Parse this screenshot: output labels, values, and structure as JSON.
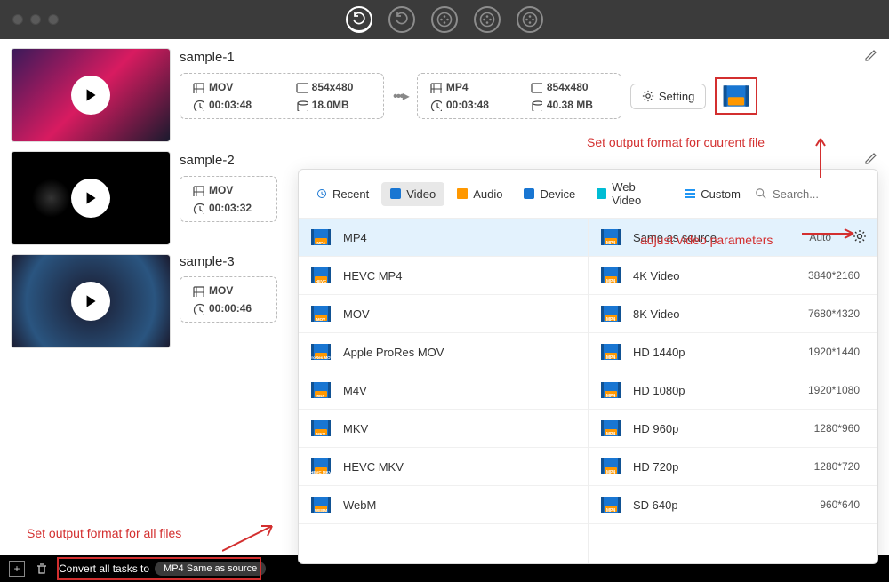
{
  "files": [
    {
      "name": "sample-1",
      "in": {
        "fmt": "MOV",
        "dur": "00:03:48",
        "res": "854x480",
        "size": "18.0MB"
      },
      "out": {
        "fmt": "MP4",
        "dur": "00:03:48",
        "res": "854x480",
        "size": "40.38 MB"
      }
    },
    {
      "name": "sample-2",
      "in": {
        "fmt": "MOV",
        "dur": "00:03:32"
      }
    },
    {
      "name": "sample-3",
      "in": {
        "fmt": "MOV",
        "dur": "00:00:46"
      }
    }
  ],
  "setting_label": "Setting",
  "annotations": {
    "current_file": "Set output format for cuurent file",
    "params": "adjust video parameters",
    "all_files": "Set output format for all files"
  },
  "panel": {
    "tabs": [
      "Recent",
      "Video",
      "Audio",
      "Device",
      "Web Video",
      "Custom"
    ],
    "search_placeholder": "Search...",
    "left": [
      "MP4",
      "HEVC MP4",
      "MOV",
      "Apple ProRes MOV",
      "M4V",
      "MKV",
      "HEVC MKV",
      "WebM"
    ],
    "left_labels": [
      "MP4",
      "HEVC",
      "MOV",
      "ProRes MOV",
      "M4V",
      "MKV",
      "HEVC MKV",
      "WEBM"
    ],
    "right": [
      {
        "name": "Same as source",
        "res": "Auto",
        "gear": true
      },
      {
        "name": "4K Video",
        "res": "3840*2160"
      },
      {
        "name": "8K Video",
        "res": "7680*4320"
      },
      {
        "name": "HD 1440p",
        "res": "1920*1440"
      },
      {
        "name": "HD 1080p",
        "res": "1920*1080"
      },
      {
        "name": "HD 960p",
        "res": "1280*960"
      },
      {
        "name": "HD 720p",
        "res": "1280*720"
      },
      {
        "name": "SD 640p",
        "res": "960*640"
      }
    ]
  },
  "bottom": {
    "convert_label": "Convert all tasks to",
    "convert_value": "MP4 Same as source"
  },
  "colors": {
    "accent": "#1976d2",
    "danger": "#d32f2f",
    "mp4_icon": "#1976d2",
    "mp4_accent": "#ff9800"
  }
}
